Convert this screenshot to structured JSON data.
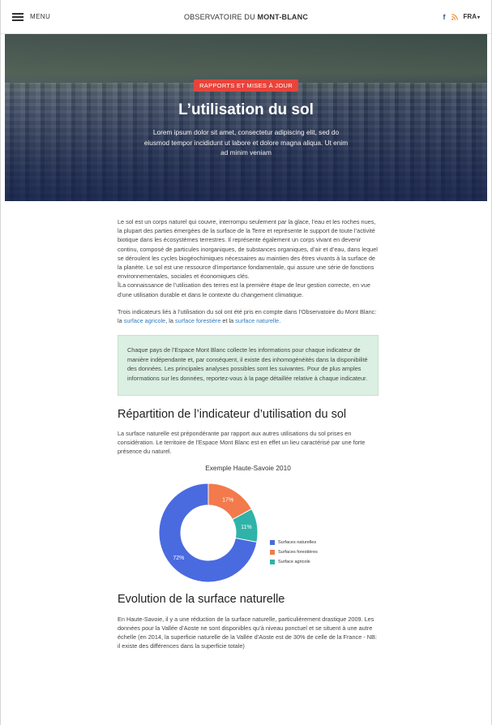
{
  "header": {
    "menu_label": "MENU",
    "site_title_prefix": "OBSERVATOIRE DU ",
    "site_title_bold": "MONT-BLANC",
    "facebook_glyph": "f",
    "language": "FRA",
    "icons": [
      "hamburger-icon",
      "facebook-icon",
      "rss-icon",
      "chevron-down-icon"
    ]
  },
  "hero": {
    "tag": "RAPPORTS ET MISES À JOUR",
    "title": "L’utilisation du sol",
    "description": "Lorem ipsum dolor sit amet, consectetur adipiscing elit, sed do eiusmod tempor incididunt ut labore et dolore magna aliqua. Ut enim ad minim veniam"
  },
  "article": {
    "intro": "Le sol est un corps naturel qui couvre, interrompu seulement par la glace, l’eau et les roches nues, la plupart des parties émergées de la surface de la Terre et représente le support de toute l’activité biotique dans les écosystèmes terrestres. Il représente également un corps vivant en devenir continu, composé de particules inorganiques, de substances organiques, d’air et d’eau, dans lequel se déroulent les cycles biogéochimiques nécessaires au maintien des êtres vivants à la surface de la planète. Le sol est une ressource d’importance fondamentale, qui assure une série de fonctions environnementales, sociales et économiques clés.",
    "intro_2": "ÎLa connaissance de l’utilisation des terres est la première étape de leur gestion correcte, en vue d’une utilisation durable et dans le contexte du changement climatique.",
    "indicators_prefix": "Trois indicateurs liés à l’utilisation du sol ont été pris en compte dans l’Observatoire du Mont Blanc: la ",
    "link_agricole": "surface agricole",
    "sep_1": ", la ",
    "link_forestiere": "surface forestière",
    "sep_2": " et la ",
    "link_naturelle": "surface naturelle",
    "indicators_suffix": ".",
    "note": "Chaque pays de l’Espace Mont Blanc collecte les informations pour chaque indicateur de manière indépendante et, par conséquent, il existe des inhomogénéités dans la disponibilité des données. Les principales analyses possibles sont les suivantes. Pour de plus amples informations sur les données, reportez-vous à la page détaillée relative à chaque indicateur.",
    "section_1_title": "Répartition de l’indicateur d’utilisation du sol",
    "section_1_text": "La surface naturelle est prépondérante par rapport aux autres utilisations du sol prises en considération. Le territoire de l’Espace Mont Blanc est en effet un lieu caractérisé par une forte présence du naturel.",
    "section_2_title": "Evolution de la surface naturelle",
    "section_2_text": "En Haute-Savoie, il y a une réduction de la surface naturelle, particulièrement drastique 2009. Les données pour la Vallée d’Aoste ne sont disponibles qu’à niveau ponctuel et se situent à une autre échelle (en 2014, la superficie naturelle de la Vallée d’Aoste est de 30% de celle de la France - NB: il existe des différences dans la superficie totale)"
  },
  "colors": {
    "tag_red": "#e8443b",
    "link_blue": "#2f7bc0",
    "note_bg": "#dbefe2"
  },
  "chart_data": {
    "type": "pie",
    "title": "Exemple Haute-Savoie 2010",
    "categories": [
      "Surfaces naturelles",
      "Surfaces forestières",
      "Surface agricole"
    ],
    "values": [
      72,
      17,
      11
    ],
    "labels": [
      "72%",
      "17%",
      "11%"
    ],
    "colors": [
      "#4a6ae0",
      "#f27a4c",
      "#2fb3a8"
    ],
    "donut": true,
    "legend_position": "right"
  }
}
